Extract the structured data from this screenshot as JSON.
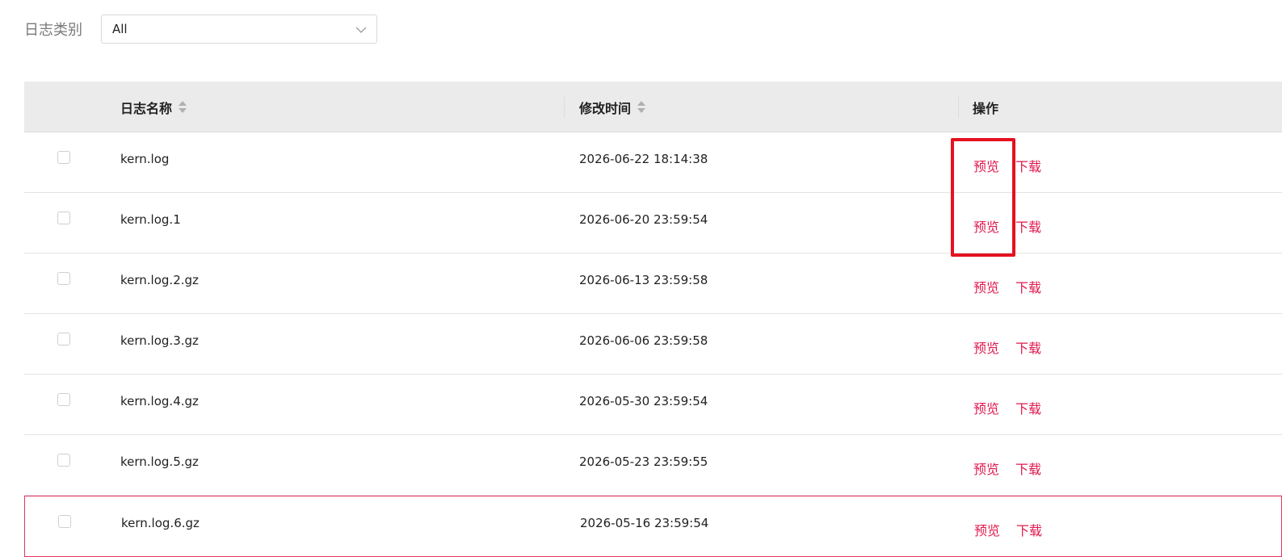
{
  "filter": {
    "label": "日志类别",
    "selected": "All",
    "arrow_icon": "chevron-down-icon"
  },
  "table": {
    "columns": {
      "name": "日志名称",
      "time": "修改时间",
      "operation": "操作"
    },
    "rows": [
      {
        "name": "kern.log",
        "time": "2026-06-22 18:14:38",
        "preview": "预览",
        "download": "下载"
      },
      {
        "name": "kern.log.1",
        "time": "2026-06-20 23:59:54",
        "preview": "预览",
        "download": "下载"
      },
      {
        "name": "kern.log.2.gz",
        "time": "2026-06-13 23:59:58",
        "preview": "预览",
        "download": "下载"
      },
      {
        "name": "kern.log.3.gz",
        "time": "2026-06-06 23:59:58",
        "preview": "预览",
        "download": "下载"
      },
      {
        "name": "kern.log.4.gz",
        "time": "2026-05-30 23:59:54",
        "preview": "预览",
        "download": "下载"
      },
      {
        "name": "kern.log.5.gz",
        "time": "2026-05-23 23:59:55",
        "preview": "预览",
        "download": "下载"
      },
      {
        "name": "kern.log.6.gz",
        "time": "2026-05-16 23:59:54",
        "preview": "预览",
        "download": "下载"
      }
    ]
  },
  "colors": {
    "action": "#e0194d",
    "annotation": "#e5121f",
    "header_bg": "#ebebeb",
    "highlight_border": "#e8335f"
  }
}
